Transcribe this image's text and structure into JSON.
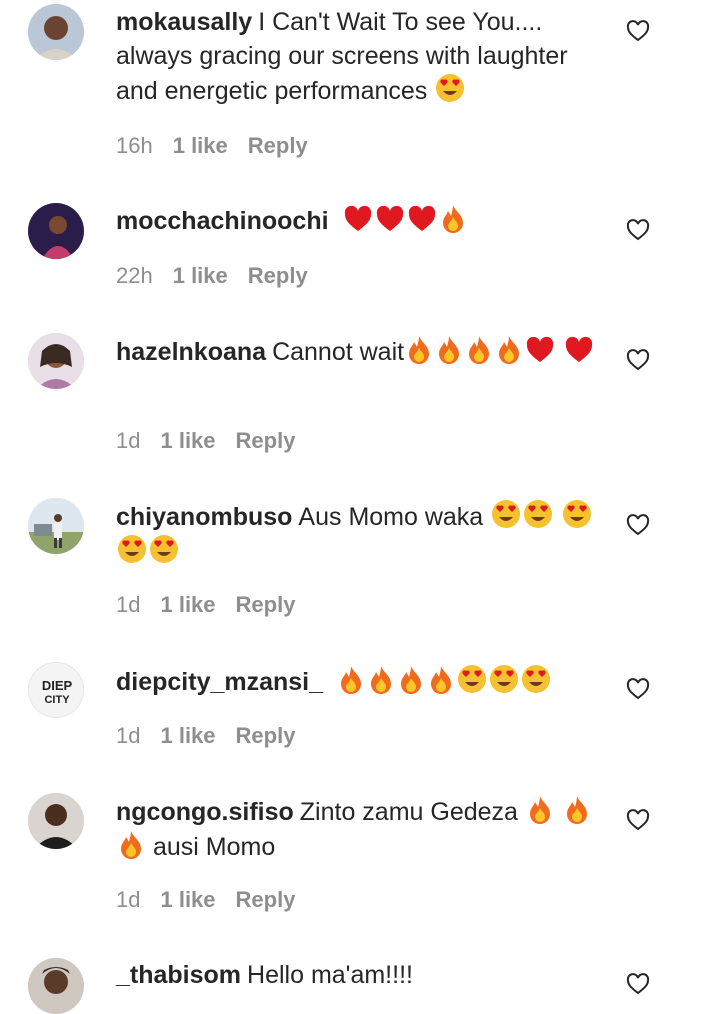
{
  "comments": [
    {
      "username": "mokausally",
      "text": "I Can't Wait To see You.... always gracing our screens with laughter and energetic performances",
      "emojis": [
        "heart-eyes"
      ],
      "time": "16h",
      "likes": "1 like",
      "reply": "Reply"
    },
    {
      "username": "mocchachinoochi",
      "text": "",
      "emojis": [
        "red-heart",
        "red-heart",
        "red-heart",
        "fire"
      ],
      "time": "22h",
      "likes": "1 like",
      "reply": "Reply"
    },
    {
      "username": "hazelnkoana",
      "text": "Cannot wait",
      "emojis": [
        "fire",
        "fire",
        "fire",
        "fire",
        "red-heart",
        "red-heart"
      ],
      "time": "1d",
      "likes": "1 like",
      "reply": "Reply"
    },
    {
      "username": "chiyanombuso",
      "text": "Aus Momo waka",
      "emojis": [
        "heart-eyes",
        "heart-eyes",
        "heart-eyes",
        "heart-eyes",
        "heart-eyes"
      ],
      "time": "1d",
      "likes": "1 like",
      "reply": "Reply"
    },
    {
      "username": "diepcity_mzansi_",
      "text": "",
      "emojis": [
        "fire",
        "fire",
        "fire",
        "fire",
        "heart-eyes",
        "heart-eyes",
        "heart-eyes"
      ],
      "time": "1d",
      "likes": "1 like",
      "reply": "Reply",
      "avatar_text": "DIEP CITY"
    },
    {
      "username": "ngcongo.sifiso",
      "text": "Zinto zamu Gedeza",
      "emojis": [
        "fire",
        "fire",
        "fire"
      ],
      "text_after": "ausi Momo",
      "time": "1d",
      "likes": "1 like",
      "reply": "Reply"
    },
    {
      "username": "_thabisom",
      "text": "Hello ma'am!!!!",
      "emojis": []
    }
  ],
  "colors": {
    "text": "#262626",
    "meta": "#8e8e8e",
    "heart_icon": "#262626",
    "emoji_heart": "#e0181f",
    "fire": "#f26b1d",
    "face": "#f5c12e"
  }
}
